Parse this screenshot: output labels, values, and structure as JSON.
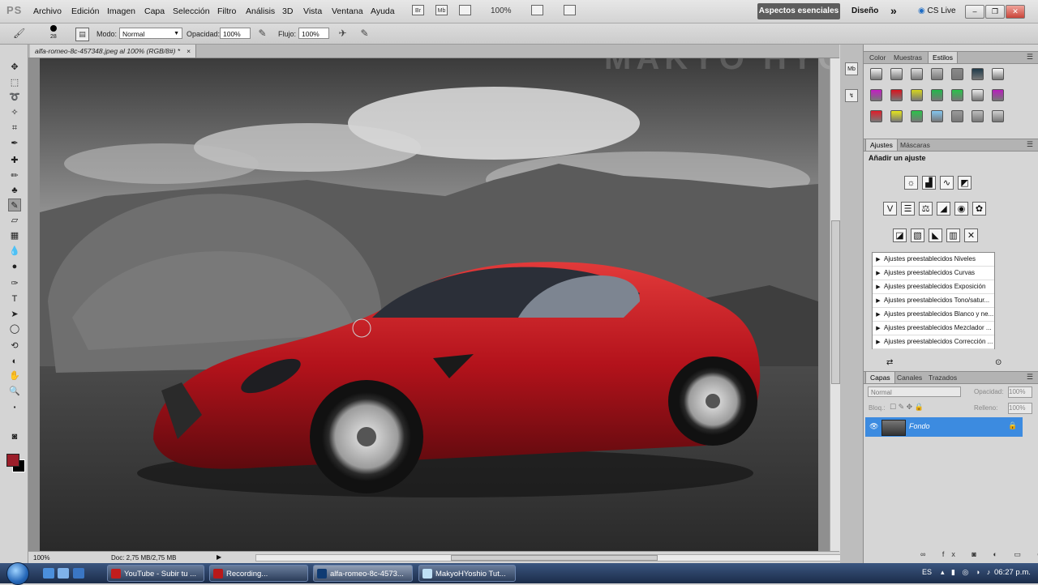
{
  "menubar": {
    "logo": "PS",
    "items": [
      "Archivo",
      "Edición",
      "Imagen",
      "Capa",
      "Selección",
      "Filtro",
      "Análisis",
      "3D",
      "Vista",
      "Ventana",
      "Ayuda"
    ],
    "bridge_label": "Br",
    "minibridge_label": "Mb",
    "zoom": "100%",
    "workspace_button": "Aspectos esenciales",
    "workspace_link": "Diseño",
    "more": "»",
    "cs_live": "CS Live"
  },
  "options": {
    "brush_size": "28",
    "mode_label": "Modo:",
    "mode_value": "Normal",
    "opacity_label": "Opacidad:",
    "opacity_value": "100%",
    "flow_label": "Flujo:",
    "flow_value": "100%"
  },
  "document": {
    "tab_title": "alfa-romeo-8c-457348.jpeg al 100% (RGB/8#) *",
    "close": "×",
    "status_zoom": "100%",
    "status_doc": "Doc: 2,75 MB/2,75 MB",
    "watermark": "MAKYO HYOSHIO"
  },
  "panels": {
    "swatches_tabs": [
      "Color",
      "Muestras",
      "Estilos"
    ],
    "adjust_tabs": [
      "Ajustes",
      "Máscaras"
    ],
    "adjust_heading": "Añadir un ajuste",
    "presets": [
      "Ajustes preestablecidos Niveles",
      "Ajustes preestablecidos Curvas",
      "Ajustes preestablecidos Exposición",
      "Ajustes preestablecidos Tono/satur...",
      "Ajustes preestablecidos Blanco y ne...",
      "Ajustes preestablecidos Mezclador ...",
      "Ajustes preestablecidos Corrección ..."
    ],
    "layer_tabs": [
      "Capas",
      "Canales",
      "Trazados"
    ],
    "blend_mode": "Normal",
    "opacity_label": "Opacidad:",
    "opacity_value": "100%",
    "lock_label": "Bloq.:",
    "fill_label": "Relleno:",
    "fill_value": "100%",
    "layer_name": "Fondo"
  },
  "taskbar": {
    "tasks": [
      "YouTube - Subir tu ...",
      "Recording...",
      "alfa-romeo-8c-4573...",
      "MakyoHYoshio Tut..."
    ],
    "language": "ES",
    "clock": "06:27 p.m."
  },
  "colors": {
    "foreground": "#9b1e2a",
    "background": "#000000",
    "selection": "#3c8be0"
  }
}
